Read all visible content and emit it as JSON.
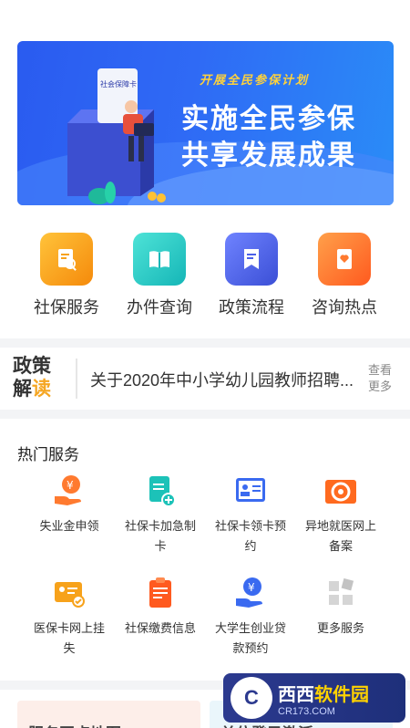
{
  "banner": {
    "plan_text": "开展全民参保计划",
    "line1": "实施全民参保",
    "line2": "共享发展成果",
    "card_text": "社会保障卡"
  },
  "quick_services": [
    {
      "label": "社保服务",
      "icon": "document-search-icon",
      "color": "#f7a21b"
    },
    {
      "label": "办件查询",
      "icon": "book-icon",
      "color": "#26c6c3"
    },
    {
      "label": "政策流程",
      "icon": "bookmark-doc-icon",
      "color": "#4a5fe8"
    },
    {
      "label": "咨询热点",
      "icon": "heart-doc-icon",
      "color": "#ff7a2f"
    }
  ],
  "policy": {
    "badge_line1": "政策",
    "badge_line2_a": "解",
    "badge_line2_b": "读",
    "news": "关于2020年中小学幼儿园教师招聘...",
    "more_line1": "查看",
    "more_line2": "更多"
  },
  "hot": {
    "title": "热门服务",
    "items": [
      {
        "label": "失业金申领",
        "icon": "hand-yuan-icon"
      },
      {
        "label": "社保卡加急制卡",
        "icon": "card-plus-icon"
      },
      {
        "label": "社保卡领卡预约",
        "icon": "id-card-icon"
      },
      {
        "label": "异地就医网上备案",
        "icon": "medical-icon"
      },
      {
        "label": "医保卡网上挂失",
        "icon": "card-check-icon"
      },
      {
        "label": "社保缴费信息",
        "icon": "clipboard-icon"
      },
      {
        "label": "大学生创业贷款预约",
        "icon": "hand-yuan-blue-icon"
      },
      {
        "label": "更多服务",
        "icon": "grid-icon"
      }
    ]
  },
  "bottom_cards": [
    {
      "text": "服务网点地图"
    },
    {
      "text": "单位登录激活"
    }
  ],
  "watermark": {
    "logo": "C",
    "main_a": "西西",
    "main_b": "软件园",
    "sub": "CR173.COM"
  }
}
